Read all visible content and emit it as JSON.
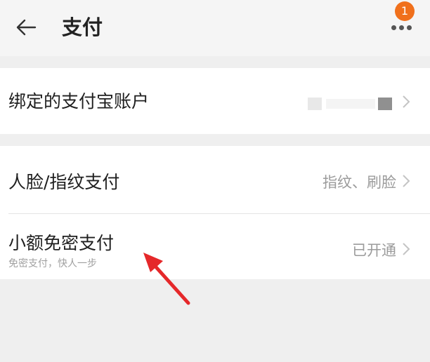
{
  "header": {
    "title": "支付",
    "back_icon": "arrow-left-icon",
    "more_icon": "more-dots-icon",
    "badge_count": "1",
    "badge_color": "#f0701c"
  },
  "rows": {
    "alipay": {
      "label": "绑定的支付宝账户",
      "value_masked": true
    },
    "face_fingerprint": {
      "label": "人脸/指纹支付",
      "value": "指纹、刷脸"
    },
    "small_password_free": {
      "label": "小额免密支付",
      "sub": "免密支付，快人一步",
      "value": "已开通"
    }
  },
  "annotation": {
    "arrow_color": "#e5282a"
  }
}
